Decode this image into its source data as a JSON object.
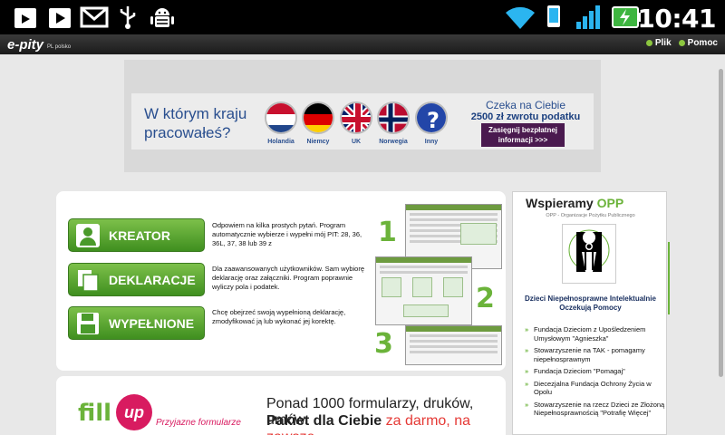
{
  "status_bar": {
    "time": "10:41",
    "icons": [
      "play-store-bag-icon",
      "play-store-icon",
      "gmail-icon",
      "usb-icon",
      "android-debug-icon",
      "wifi-icon",
      "phone-rotate-icon",
      "signal-icon",
      "battery-charging-icon"
    ]
  },
  "app_header": {
    "logo_text": "e-pity",
    "logo_sub": "PL polsko",
    "menu": [
      {
        "label": "Plik"
      },
      {
        "label": "Pomoc"
      }
    ]
  },
  "banner": {
    "question": "W którym kraju pracowałeś?",
    "countries": [
      "Holandia",
      "Niemcy",
      "UK",
      "Norwegia",
      "Inny"
    ],
    "line1": "Czeka na Ciebie",
    "line2": "2500 zł zwrotu podatku",
    "cta": "Zasięgnij bezpłatnej informacji >>>"
  },
  "main_panel": {
    "buttons": [
      {
        "label": "KREATOR",
        "icon": "person-icon",
        "desc": "Odpowiem na kilka prostych pytań. Program automatycznie wybierze i wypełni mój PIT: 28, 36, 36L, 37, 38 lub 39 z"
      },
      {
        "label": "DEKLARACJE",
        "icon": "documents-icon",
        "desc": "Dla zaawansowanych użytkowników. Sam wybiorę deklarację oraz załączniki. Program poprawnie wyliczy pola i podatek."
      },
      {
        "label": "WYPEŁNIONE",
        "icon": "floppy-disk-icon",
        "desc": "Chcę obejrzeć swoją wypełnioną deklarację, zmodyfikować ją lub wykonać jej korektę."
      }
    ],
    "step_numbers": [
      "1",
      "2",
      "3"
    ]
  },
  "opp": {
    "title_prefix": "Wspieramy ",
    "title_accent": "OPP",
    "subtitle": "OPP - Organizacje Pożytku Publicznego",
    "org_name": "Dzieci Niepełnosprawne Intelektualnie Oczekują Pomocy",
    "list": [
      "Fundacja Dzieciom z Upośledzeniem Umysłowym \"Agnieszka\"",
      "Stowarzyszenie na TAK - pomagamy niepełnosprawnym",
      "Fundacja Dzieciom \"Pomagaj\"",
      "Diecezjalna Fundacja Ochrony Życia w Opolu",
      "Stowarzyszenie na rzecz Dzieci ze Złożoną Niepełnosprawnością \"Potrafię Więcej\""
    ]
  },
  "fillup": {
    "logo_fill": "fill",
    "logo_up": "up",
    "tagline": "Przyjazne formularze",
    "headline1": "Ponad 1000 formularzy, druków, umów.",
    "headline2_bold": "Pakiet dla Ciebie ",
    "headline2_red": "za darmo, na zawsze."
  },
  "colors": {
    "accent_green": "#6bb33a",
    "button_green": "#4a9a2a",
    "banner_blue": "#2a4f8f",
    "cta_purple": "#4a1a4f",
    "fillup_pink": "#d81b60"
  }
}
